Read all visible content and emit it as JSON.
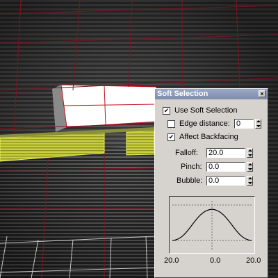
{
  "viewport": {
    "grid_color": "#7d1420",
    "floor_grid_color": "#d8d8d8"
  },
  "soft_selection": {
    "title": "Soft Selection",
    "close_label": "×",
    "use_soft_selection": {
      "label": "Use Soft Selection",
      "checked": true
    },
    "edge_distance": {
      "label": "Edge distance:",
      "checked": false,
      "value": "0"
    },
    "affect_backfacing": {
      "label": "Affect Backfacing",
      "checked": true
    },
    "falloff": {
      "label": "Falloff:",
      "value": "20.0"
    },
    "pinch": {
      "label": "Pinch:",
      "value": "0.0"
    },
    "bubble": {
      "label": "Bubble:",
      "value": "0.0"
    },
    "curve_labels": {
      "left": "20.0",
      "center": "0.0",
      "right": "20.0"
    }
  }
}
